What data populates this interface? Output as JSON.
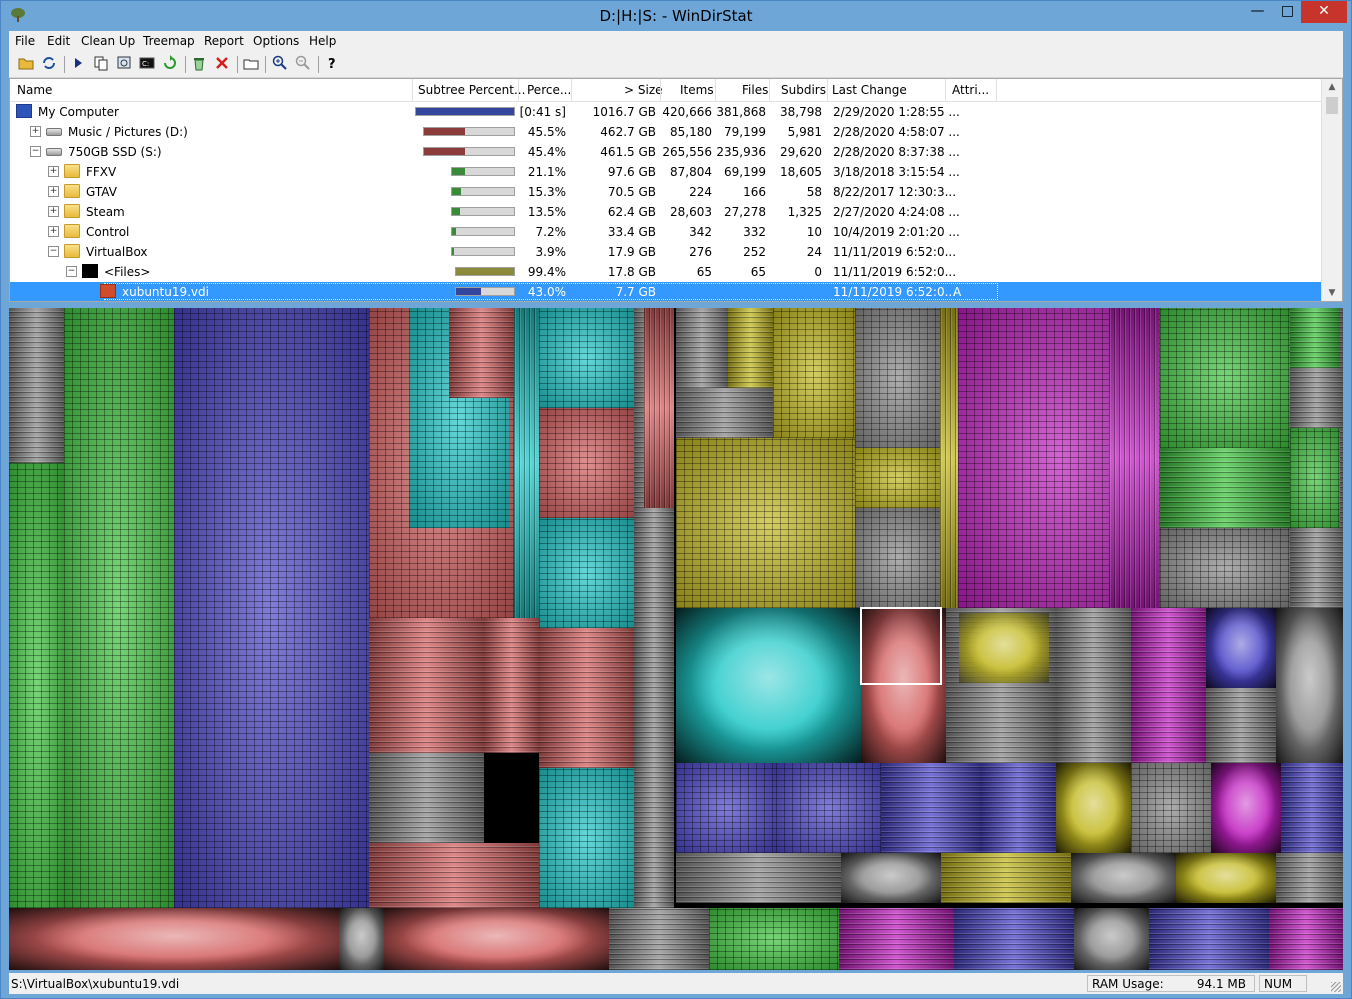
{
  "window": {
    "title": "D:|H:|S: - WinDirStat",
    "minimize": "—",
    "maximize": "□",
    "close": "✕"
  },
  "menu": [
    "File",
    "Edit",
    "Clean Up",
    "Treemap",
    "Report",
    "Options",
    "Help"
  ],
  "toolbar": [
    "open-icon",
    "refresh-icon",
    "play-icon",
    "copy-icon",
    "explorer-icon",
    "cmd-icon",
    "refresh-selected-icon",
    "recycle-icon",
    "delete-icon",
    "properties-icon",
    "zoom-in-icon",
    "zoom-out-icon",
    "help-icon"
  ],
  "columns": [
    "Name",
    "Subtree Percent...",
    "Perce...",
    "> Size",
    "Items",
    "Files",
    "Subdirs",
    "Last Change",
    "Attri..."
  ],
  "rows": [
    {
      "name": "My Computer",
      "bar": 1.0,
      "bar_color": "#34459d",
      "pct": "[0:41 s]",
      "size": "1016.7 GB",
      "items": "420,666",
      "files": "381,868",
      "subdirs": "38,798",
      "last": "2/29/2020  1:28:55 ...",
      "attr": "",
      "icon": "computer-icon",
      "expander": ""
    },
    {
      "name": "Music / Pictures (D:)",
      "bar": 0.455,
      "bar_color": "#8c3b3b",
      "pct": "45.5%",
      "size": "462.7 GB",
      "items": "85,180",
      "files": "79,199",
      "subdirs": "5,981",
      "last": "2/28/2020  4:58:07 ...",
      "attr": "",
      "icon": "drive-icon",
      "expander": "+"
    },
    {
      "name": "750GB SSD (S:)",
      "bar": 0.454,
      "bar_color": "#8c3b3b",
      "pct": "45.4%",
      "size": "461.5 GB",
      "items": "265,556",
      "files": "235,936",
      "subdirs": "29,620",
      "last": "2/28/2020  8:37:38 ...",
      "attr": "",
      "icon": "drive-icon",
      "expander": "−"
    },
    {
      "name": "FFXV",
      "bar": 0.211,
      "bar_color": "#3a8a3a",
      "pct": "21.1%",
      "size": "97.6 GB",
      "items": "87,804",
      "files": "69,199",
      "subdirs": "18,605",
      "last": "3/18/2018  3:15:54 ...",
      "attr": "",
      "icon": "folder-icon",
      "expander": "+"
    },
    {
      "name": "GTAV",
      "bar": 0.153,
      "bar_color": "#3a8a3a",
      "pct": "15.3%",
      "size": "70.5 GB",
      "items": "224",
      "files": "166",
      "subdirs": "58",
      "last": "8/22/2017  12:30:3...",
      "attr": "",
      "icon": "folder-icon",
      "expander": "+"
    },
    {
      "name": "Steam",
      "bar": 0.135,
      "bar_color": "#3a8a3a",
      "pct": "13.5%",
      "size": "62.4 GB",
      "items": "28,603",
      "files": "27,278",
      "subdirs": "1,325",
      "last": "2/27/2020  4:24:08 ...",
      "attr": "",
      "icon": "folder-icon",
      "expander": "+"
    },
    {
      "name": "Control",
      "bar": 0.072,
      "bar_color": "#3a8a3a",
      "pct": "7.2%",
      "size": "33.4 GB",
      "items": "342",
      "files": "332",
      "subdirs": "10",
      "last": "10/4/2019  2:01:20 ...",
      "attr": "",
      "icon": "folder-icon",
      "expander": "+"
    },
    {
      "name": "VirtualBox",
      "bar": 0.039,
      "bar_color": "#3a8a3a",
      "pct": "3.9%",
      "size": "17.9 GB",
      "items": "276",
      "files": "252",
      "subdirs": "24",
      "last": "11/11/2019  6:52:0...",
      "attr": "",
      "icon": "folder-icon",
      "expander": "−"
    },
    {
      "name": "<Files>",
      "bar": 0.994,
      "bar_color": "#8a8a3a",
      "pct": "99.4%",
      "size": "17.8 GB",
      "items": "65",
      "files": "65",
      "subdirs": "0",
      "last": "11/11/2019  6:52:0...",
      "attr": "",
      "icon": "files-icon",
      "expander": "−"
    },
    {
      "name": "xubuntu19.vdi",
      "bar": 0.43,
      "bar_color": "#34459d",
      "pct": "43.0%",
      "size": "7.7 GB",
      "items": "",
      "files": "",
      "subdirs": "",
      "last": "11/11/2019  6:52:0...",
      "attr": "A",
      "icon": "vdi-file-icon",
      "expander": "",
      "selected": true
    }
  ],
  "status": {
    "path": "S:\\VirtualBox\\xubuntu19.vdi",
    "ram_label": "RAM Usage:",
    "ram_value": "94.1 MB",
    "num": "NUM"
  },
  "treemap_colors": {
    "blue": "#4a45c8",
    "red": "#d36060",
    "green": "#3ec43e",
    "cyan": "#22c8c8",
    "yellow": "#c2b820",
    "magenta": "#c020c0",
    "gray": "#8a8a8a",
    "highlight": "#ffffff"
  }
}
